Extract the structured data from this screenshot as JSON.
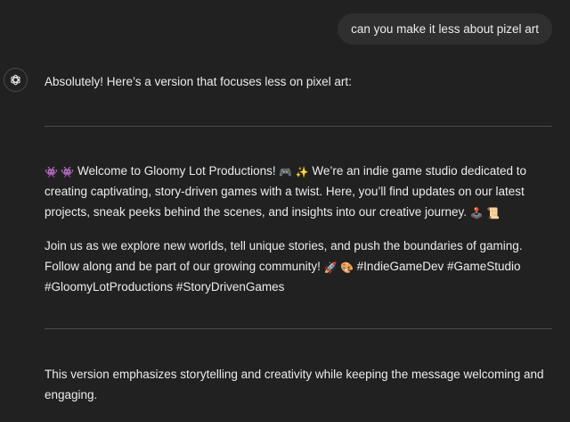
{
  "user_message": "can you make it less about pizel art",
  "assistant": {
    "intro": "Absolutely! Here’s a version that focuses less on pixel art:",
    "post": {
      "p1_emoji_start": "👾 👾",
      "p1_text_a": "Welcome to Gloomy Lot Productions!",
      "p1_emoji_mid": "🎮 ✨",
      "p1_text_b": "We’re an indie game studio dedicated to creating captivating, story-driven games with a twist. Here, you’ll find updates on our latest projects, sneak peeks behind the scenes, and insights into our creative journey.",
      "p1_emoji_end": "🕹️ 📜",
      "p2_text_a": "Join us as we explore new worlds, tell unique stories, and push the boundaries of gaming. Follow along and be part of our growing community!",
      "p2_emoji": "🚀 🎨",
      "p2_hashtags": "#IndieGameDev #GameStudio #GloomyLotProductions #StoryDrivenGames"
    },
    "outro": "This version emphasizes storytelling and creativity while keeping the message welcoming and engaging."
  },
  "colors": {
    "background": "#212121",
    "user_bubble": "#2f2f2f",
    "text": "#ececec",
    "divider": "#4a4a4a"
  },
  "icons": {
    "assistant_avatar": "openai-logo-icon"
  }
}
